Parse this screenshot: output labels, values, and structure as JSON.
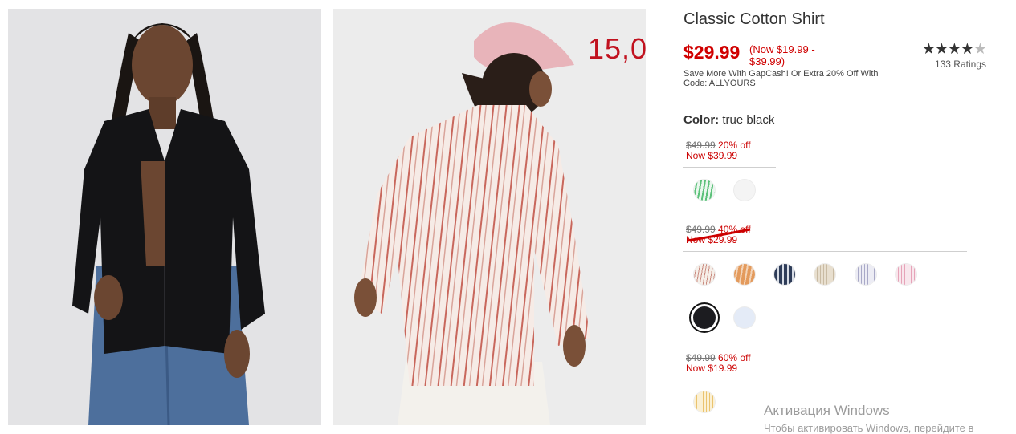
{
  "product": {
    "title": "Classic Cotton Shirt",
    "price": "$29.99",
    "price_range": "(Now $19.99 - $39.99)",
    "promo": "Save More With GapCash! Or Extra 20% Off With Code: ALLYOURS"
  },
  "rating": {
    "stars": 4.5,
    "stars_full": "★★★★",
    "stars_half": "★",
    "count_label": "133 Ratings"
  },
  "overlay_number": "15,0",
  "color": {
    "label": "Color:",
    "value": "true black"
  },
  "price_groups": [
    {
      "old_price": "$49.99",
      "discount": "20% off",
      "now_price": "Now $39.99",
      "swatches": [
        {
          "name": "green-stripe",
          "color": "#6fcf8a"
        },
        {
          "name": "white",
          "color": "#f5f5f5"
        }
      ]
    },
    {
      "old_price": "$49.99",
      "discount": "40% off",
      "now_price": "Now $29.99",
      "swatches": [
        {
          "name": "pink-stripe",
          "color": "#efe3dc"
        },
        {
          "name": "orange-stripe",
          "color": "#e39a5c"
        },
        {
          "name": "navy-stripe",
          "color": "#3a4a66"
        },
        {
          "name": "beige-stripe",
          "color": "#ddd3c1"
        },
        {
          "name": "lavender-stripe",
          "color": "#d8d8e8"
        },
        {
          "name": "rose-stripe",
          "color": "#f0c6d2"
        },
        {
          "name": "true-black",
          "color": "#1c1c20",
          "selected": true
        },
        {
          "name": "light-blue",
          "color": "#e4ebf7"
        }
      ]
    },
    {
      "old_price": "$49.99",
      "discount": "60% off",
      "now_price": "Now $19.99",
      "swatches": [
        {
          "name": "yellow-stripe",
          "color": "#f5dfa9"
        }
      ]
    }
  ],
  "watermark": {
    "line1": "Активация Windows",
    "line2": "Чтобы активировать Windows, перейдите в"
  },
  "images": {
    "primary_alt": "model-black-shirt",
    "secondary_alt": "model-striped-shirt"
  }
}
